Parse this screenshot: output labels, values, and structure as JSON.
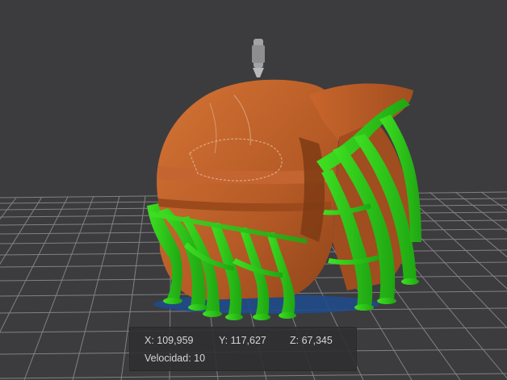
{
  "readout": {
    "x": "X: 109,959",
    "y": "Y: 117,627",
    "z": "Z: 67,345",
    "speed": "Velocidad: 10"
  },
  "colors": {
    "background": "#3c3c3e",
    "grid_line": "#8e8e90",
    "model": "#b55a26",
    "model_highlight": "#cf6f34",
    "supports": "#2fcc1a",
    "support_base": "#1f4a8a",
    "nozzle": "#9a9a9a"
  },
  "icons": {
    "nozzle": "extruder-nozzle-icon"
  }
}
